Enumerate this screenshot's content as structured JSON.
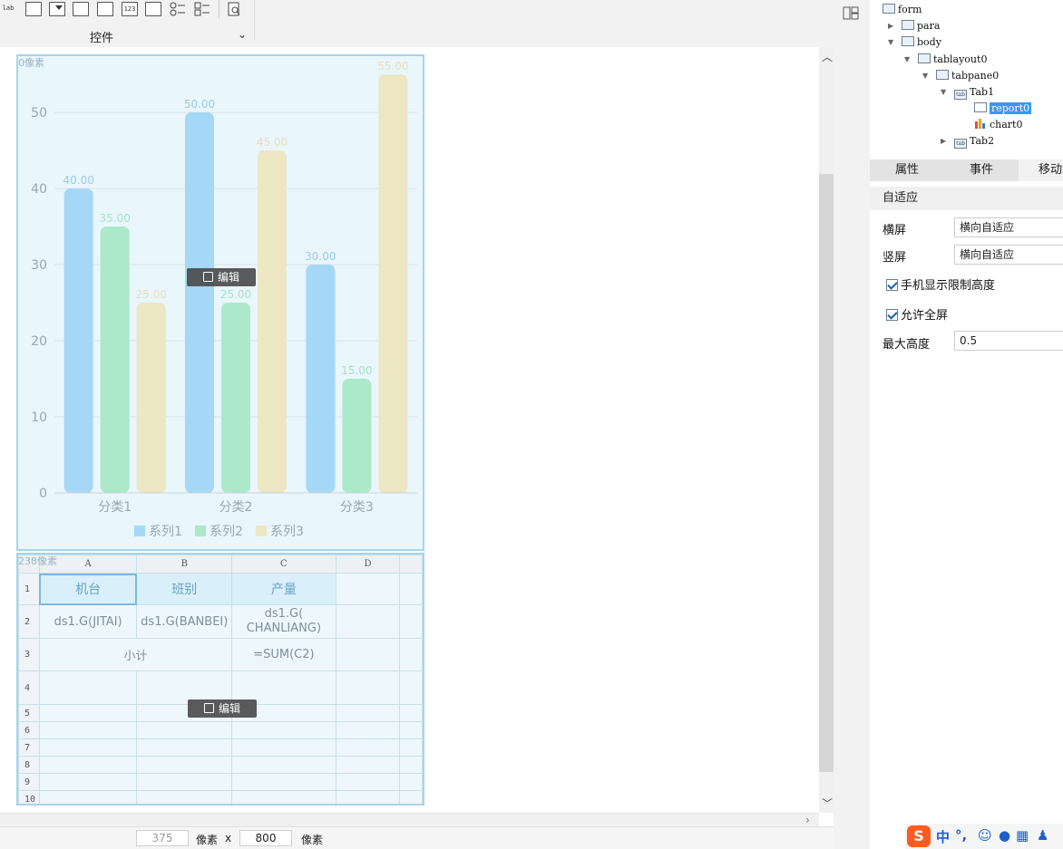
{
  "toolbar": {
    "label": "控件",
    "tools": [
      "lab-icon",
      "textbox-icon",
      "combobox-icon",
      "date-icon",
      "calendar-icon",
      "number-icon",
      "list-icon",
      "radio-group-icon",
      "checkbox-group-icon",
      "search-preview-icon"
    ],
    "lab_text": "lab",
    "num_text": "123"
  },
  "chart_widget": {
    "size_label": "0像素",
    "edit_label": "编辑"
  },
  "chart_data": {
    "type": "bar",
    "categories": [
      "分类1",
      "分类2",
      "分类3"
    ],
    "series": [
      {
        "name": "系列1",
        "values": [
          40,
          50,
          30
        ],
        "color": "#a5d8f7"
      },
      {
        "name": "系列2",
        "values": [
          35,
          25,
          15
        ],
        "color": "#ace9c9"
      },
      {
        "name": "系列3",
        "values": [
          25,
          45,
          55
        ],
        "color": "#ece6c3"
      }
    ],
    "data_labels": {
      "series1": [
        "40.00",
        "50.00",
        "30.00"
      ],
      "series2": [
        "35.00",
        "25.00",
        "15.00"
      ],
      "series3": [
        "25.00",
        "45.00",
        "55.00"
      ]
    },
    "label_colors": [
      "#9ccbe8",
      "#a8e2c2",
      "#e6dfb8"
    ],
    "yticks": [
      "0",
      "10",
      "20",
      "30",
      "40",
      "50"
    ],
    "ylim": [
      0,
      55
    ],
    "grid": true,
    "legend": "bottom"
  },
  "report_widget": {
    "size_label": "238像素",
    "edit_label": "编辑",
    "columns": [
      "A",
      "B",
      "C",
      "D"
    ],
    "rows": [
      "1",
      "2",
      "3",
      "4",
      "5",
      "6",
      "7",
      "8",
      "9",
      "10"
    ],
    "cells": {
      "a1": "机台",
      "b1": "班别",
      "c1": "产量",
      "a2": "ds1.G(JITAI)",
      "b2": "ds1.G(BANBEI)",
      "c2": "ds1.G( CHANLIANG)",
      "a3": "小计",
      "c3": "=SUM(C2)"
    }
  },
  "tree": {
    "form": "form",
    "para": "para",
    "body": "body",
    "tablayout": "tablayout0",
    "tabpane": "tabpane0",
    "tab1": "Tab1",
    "report": "report0",
    "chart": "chart0",
    "tab2": "Tab2",
    "tab_badge": "tab"
  },
  "panel_tabs": [
    "属性",
    "事件",
    "移动端"
  ],
  "props": {
    "section": "自适应",
    "landscape_label": "横屏",
    "landscape_value": "横向自适应",
    "portrait_label": "竖屏",
    "portrait_value": "横向自适应",
    "mobile_limit_height": "手机显示限制高度",
    "allow_fullscreen": "允许全屏",
    "max_height_label": "最大高度",
    "max_height_value": "0.5"
  },
  "statusbar": {
    "width": "375",
    "unit1": "像素",
    "times": "x",
    "height": "800",
    "unit2": "像素"
  },
  "ime": {
    "logo": "S",
    "mode": "中",
    "punct": "°,"
  }
}
